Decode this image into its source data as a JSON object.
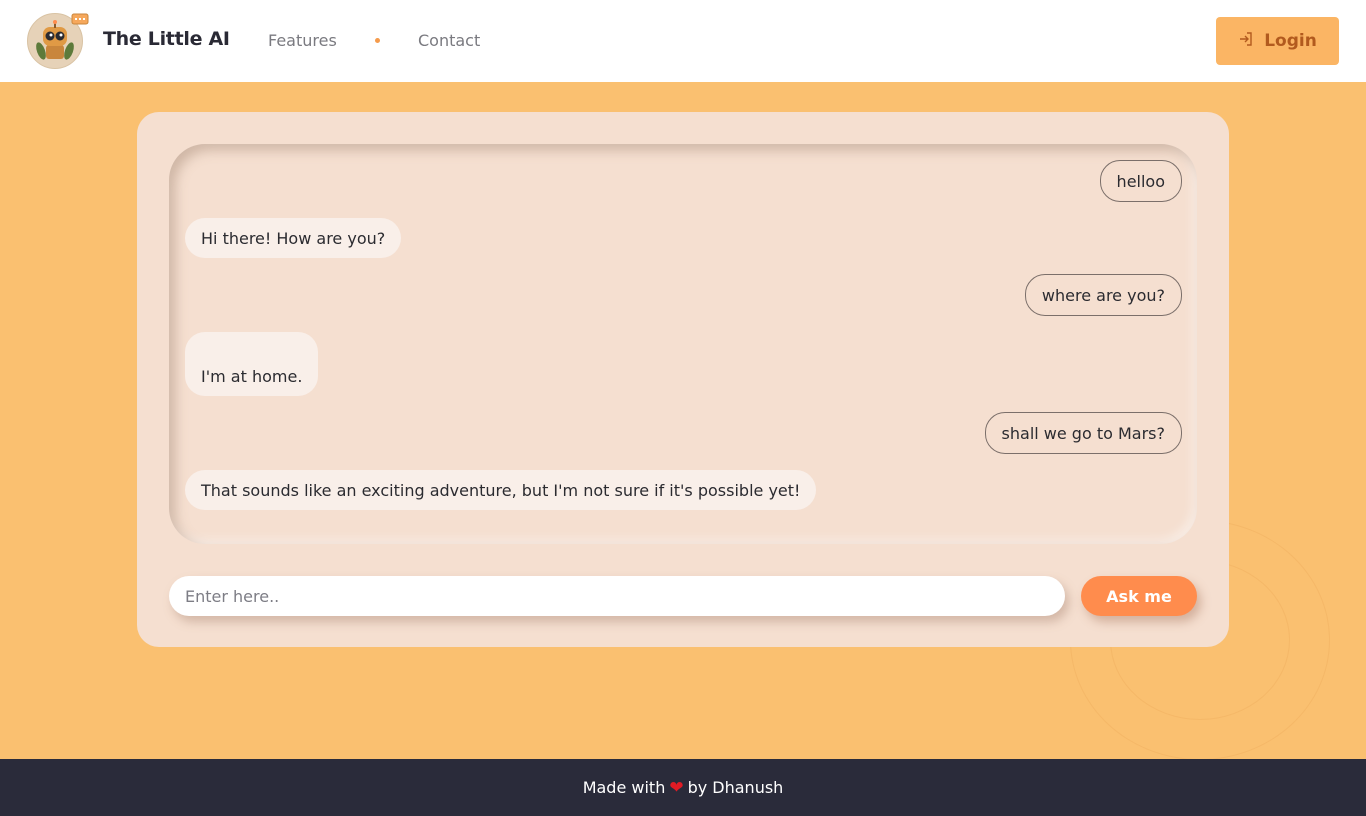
{
  "navbar": {
    "brand": "The Little AI",
    "links": [
      "Features",
      "Contact"
    ],
    "login_label": "Login"
  },
  "chat": {
    "messages": [
      {
        "role": "user",
        "text": "helloo"
      },
      {
        "role": "bot",
        "text": "Hi there! How are you?"
      },
      {
        "role": "user",
        "text": "where are you?"
      },
      {
        "role": "bot",
        "text": "I'm at home."
      },
      {
        "role": "user",
        "text": "shall we go to Mars?"
      },
      {
        "role": "bot",
        "text": "That sounds like an exciting adventure, but I'm not sure if it's possible yet!"
      }
    ],
    "input_placeholder": "Enter here..",
    "ask_label": "Ask me"
  },
  "footer": {
    "made_with": "Made with",
    "by": "by Dhanush"
  },
  "icons": {
    "logo": "robot-avatar-icon",
    "login": "login-arrow-icon",
    "heart": "heart-icon"
  },
  "colors": {
    "background": "#fac070",
    "accent": "#ff8c4d",
    "login_button": "#fbb564",
    "footer": "#2a2b3a"
  }
}
